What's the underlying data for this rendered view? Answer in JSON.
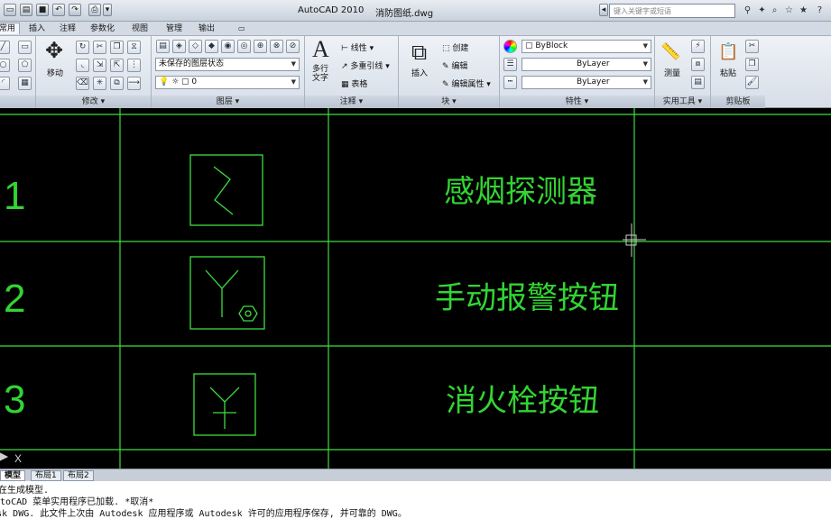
{
  "window": {
    "app_title": "AutoCAD 2010",
    "file_title": "消防图纸.dwg",
    "search_placeholder": "键入关键字或短语"
  },
  "quick_access": [
    "new-icon",
    "open-icon",
    "save-icon",
    "undo-icon",
    "redo-icon",
    "print-icon"
  ],
  "ribbon_tabs": [
    {
      "label": "常用",
      "active": true
    },
    {
      "label": "插入",
      "active": false
    },
    {
      "label": "注释",
      "active": false
    },
    {
      "label": "参数化",
      "active": false
    },
    {
      "label": "视图",
      "active": false
    },
    {
      "label": "管理",
      "active": false
    },
    {
      "label": "输出",
      "active": false
    }
  ],
  "panels": {
    "modify": {
      "label": "修改",
      "move_label": "移动"
    },
    "layers": {
      "label": "图层",
      "state": "未保存的图层状态",
      "current_layer": "0"
    },
    "annotation": {
      "label": "注释",
      "mtext": "多行\n文字",
      "linear": "线性",
      "mleader": "多重引线",
      "table": "表格"
    },
    "block": {
      "label": "块",
      "insert": "插入",
      "create": "创建",
      "edit": "编辑",
      "edit_attr": "编辑属性"
    },
    "properties": {
      "label": "特性",
      "color": "ByBlock",
      "linetype": "ByLayer",
      "lineweight": "ByLayer"
    },
    "utilities": {
      "label": "实用工具",
      "measure": "测量"
    },
    "clipboard": {
      "label": "剪贴板",
      "paste": "粘贴"
    }
  },
  "drawing": {
    "rows": [
      {
        "number": "1",
        "symbol": "smoke-detector",
        "name": "感烟探测器"
      },
      {
        "number": "2",
        "symbol": "manual-alarm-button",
        "name": "手动报警按钮"
      },
      {
        "number": "3",
        "symbol": "hydrant-button",
        "name": "消火栓按钮"
      }
    ],
    "line_color": "#3fdc3f",
    "text_color": "#33d433"
  },
  "layout_tabs": [
    {
      "label": "模型",
      "active": true
    },
    {
      "label": "布局1",
      "active": false
    },
    {
      "label": "布局2",
      "active": false
    }
  ],
  "command_window": {
    "lines": [
      "正在生成模型.",
      "AutoCAD 菜单实用程序已加载. *取消*",
      "Autodesk DWG.  此文件上次由 Autodesk 应用程序或 Autodesk 许可的应用程序保存, 并可靠的 DWG。"
    ]
  }
}
